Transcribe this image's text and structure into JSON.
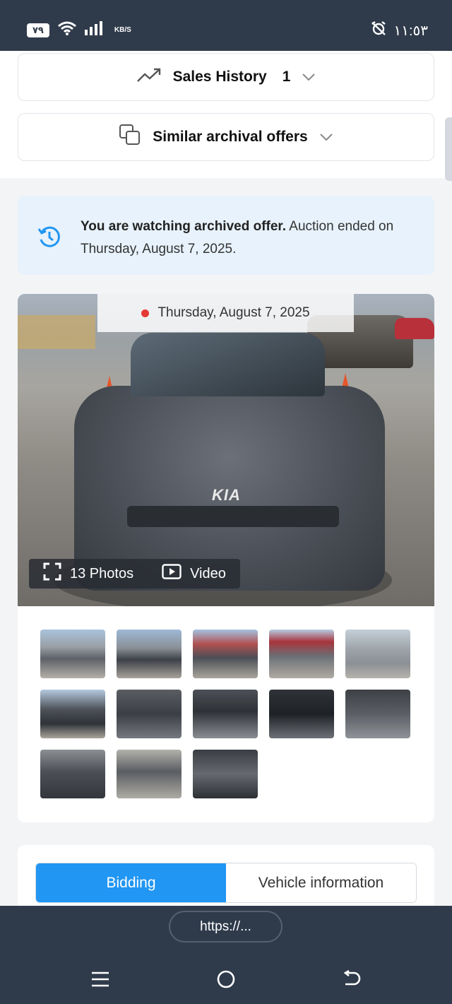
{
  "status_bar": {
    "battery": "٧٩",
    "network_speed_unit": "KB/S",
    "time": "١١:٥٣",
    "icons": [
      "wifi-icon",
      "signal-icon",
      "alarm-off-icon"
    ]
  },
  "accordions": [
    {
      "label": "Sales History",
      "count": "1",
      "icon": "trending-up-icon"
    },
    {
      "label": "Similar archival offers",
      "icon": "copy-icon"
    }
  ],
  "archive_notice": {
    "strong": "You are watching archived offer.",
    "text": " Auction ended on Thursday, August 7, 2025.",
    "icon": "history-icon"
  },
  "gallery": {
    "date": "Thursday, August 7, 2025",
    "photos_label": "13 Photos",
    "video_label": "Video",
    "logo_text": "KIA",
    "thumbnail_count": 13
  },
  "tabs": [
    {
      "label": "Bidding",
      "active": true
    },
    {
      "label": "Vehicle information",
      "active": false
    }
  ],
  "browser": {
    "url": "https://...",
    "nav": [
      "menu-icon",
      "home-icon",
      "back-icon"
    ]
  },
  "colors": {
    "accent": "#2196f3",
    "notice_bg": "#e7f2fc",
    "bars": "#2f3b4b",
    "live_dot": "#e53935"
  }
}
